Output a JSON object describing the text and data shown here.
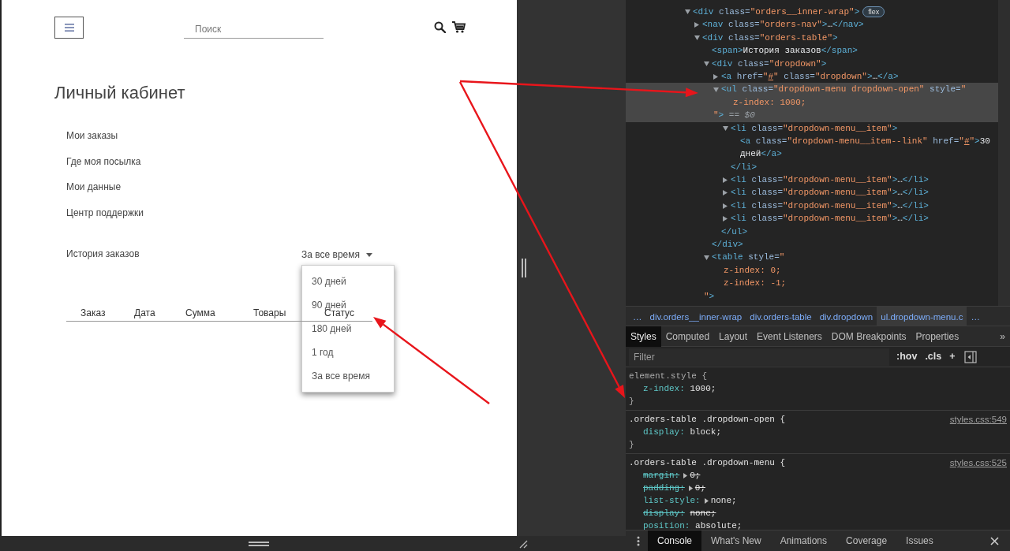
{
  "page": {
    "search": {
      "placeholder": "Поиск"
    },
    "title": "Личный кабинет",
    "nav": [
      {
        "label": "Мои заказы"
      },
      {
        "label": "Где моя посылка"
      },
      {
        "label": "Мои данные"
      },
      {
        "label": "Центр поддержки"
      }
    ],
    "orders": {
      "label": "История заказов",
      "period": {
        "value": "За все время",
        "expanded": true
      },
      "menu": [
        "30 дней",
        "90 дней",
        "180 дней",
        "1 год",
        "За все время"
      ],
      "columns": [
        "Заказ",
        "Дата",
        "Сумма",
        "Товары",
        "Статус"
      ]
    }
  },
  "devtools": {
    "dom_tree": [
      {
        "selected": false,
        "expanded": true,
        "badge": "flex",
        "parts": [
          {
            "kind": "tag",
            "text": "<div "
          },
          {
            "kind": "attr",
            "text": "class="
          },
          {
            "kind": "value",
            "text": "\"orders__inner-wrap\""
          },
          {
            "kind": "tag",
            "text": ">"
          }
        ],
        "children": [
          {
            "selected": false,
            "expanded": false,
            "parts": [
              {
                "kind": "tag",
                "text": "<nav "
              },
              {
                "kind": "attr",
                "text": "class="
              },
              {
                "kind": "value",
                "text": "\"orders-nav\""
              },
              {
                "kind": "tag",
                "text": ">"
              },
              {
                "kind": "text",
                "text": "…"
              },
              {
                "kind": "tag",
                "text": "</nav>"
              }
            ]
          },
          {
            "selected": false,
            "expanded": true,
            "parts": [
              {
                "kind": "tag",
                "text": "<div "
              },
              {
                "kind": "attr",
                "text": "class="
              },
              {
                "kind": "value",
                "text": "\"orders-table\""
              },
              {
                "kind": "tag",
                "text": ">"
              }
            ],
            "children": [
              {
                "selected": false,
                "parts": [
                  {
                    "kind": "tag",
                    "text": "<span>"
                  },
                  {
                    "kind": "text",
                    "text": "История заказов"
                  },
                  {
                    "kind": "tag",
                    "text": "</span>"
                  }
                ]
              },
              {
                "selected": false,
                "expanded": true,
                "parts": [
                  {
                    "kind": "tag",
                    "text": "<div "
                  },
                  {
                    "kind": "attr",
                    "text": "class="
                  },
                  {
                    "kind": "value",
                    "text": "\"dropdown\""
                  },
                  {
                    "kind": "tag",
                    "text": ">"
                  }
                ],
                "close": [
                  {
                    "kind": "tag",
                    "text": "</div>"
                  }
                ],
                "children": [
                  {
                    "selected": false,
                    "expanded": false,
                    "parts": [
                      {
                        "kind": "tag",
                        "text": "<a "
                      },
                      {
                        "kind": "attr",
                        "text": "href="
                      },
                      {
                        "kind": "value",
                        "text": "\""
                      },
                      {
                        "kind": "link",
                        "text": "#"
                      },
                      {
                        "kind": "value",
                        "text": "\""
                      },
                      {
                        "kind": "attr",
                        "text": " class="
                      },
                      {
                        "kind": "value",
                        "text": "\"dropdown\""
                      },
                      {
                        "kind": "tag",
                        "text": ">"
                      },
                      {
                        "kind": "text",
                        "text": "…"
                      },
                      {
                        "kind": "tag",
                        "text": "</a>"
                      }
                    ]
                  },
                  {
                    "selected": true,
                    "expanded": true,
                    "parts": [
                      {
                        "kind": "tag",
                        "text": "<ul "
                      },
                      {
                        "kind": "attr",
                        "text": "class="
                      },
                      {
                        "kind": "value",
                        "text": "\"dropdown-menu dropdown-open\""
                      },
                      {
                        "kind": "attr",
                        "text": " style="
                      },
                      {
                        "kind": "value",
                        "text": "\""
                      }
                    ],
                    "more_lines": [
                      {
                        "kind": "style",
                        "parts": [
                          {
                            "kind": "value",
                            "text": "z-index: 1000;"
                          }
                        ]
                      },
                      {
                        "kind": "closing",
                        "parts": [
                          {
                            "kind": "value",
                            "text": "\""
                          },
                          {
                            "kind": "tag",
                            "text": ">"
                          },
                          {
                            "kind": "dim",
                            "text": " == $0"
                          }
                        ]
                      }
                    ],
                    "close": [
                      {
                        "kind": "tag",
                        "text": "</ul>"
                      }
                    ],
                    "children": [
                      {
                        "selected": false,
                        "expanded": true,
                        "parts": [
                          {
                            "kind": "tag",
                            "text": "<li "
                          },
                          {
                            "kind": "attr",
                            "text": "class="
                          },
                          {
                            "kind": "value",
                            "text": "\"dropdown-menu__item\""
                          },
                          {
                            "kind": "tag",
                            "text": ">"
                          }
                        ],
                        "close": [
                          {
                            "kind": "tag",
                            "text": "</li>"
                          }
                        ],
                        "children": [
                          {
                            "selected": false,
                            "parts": [
                              {
                                "kind": "tag",
                                "text": "<a "
                              },
                              {
                                "kind": "attr",
                                "text": "class="
                              },
                              {
                                "kind": "value",
                                "text": "\"dropdown-menu__item--link\""
                              },
                              {
                                "kind": "attr",
                                "text": " href="
                              },
                              {
                                "kind": "value",
                                "text": "\""
                              },
                              {
                                "kind": "link",
                                "text": "#"
                              },
                              {
                                "kind": "value",
                                "text": "\""
                              },
                              {
                                "kind": "tag",
                                "text": ">"
                              },
                              {
                                "kind": "text",
                                "text": "30"
                              }
                            ],
                            "more_lines": [
                              {
                                "kind": "wrap",
                                "parts": [
                                  {
                                    "kind": "text",
                                    "text": "дней"
                                  },
                                  {
                                    "kind": "tag",
                                    "text": "</a>"
                                  }
                                ]
                              }
                            ]
                          }
                        ]
                      },
                      {
                        "selected": false,
                        "expanded": false,
                        "parts": [
                          {
                            "kind": "tag",
                            "text": "<li "
                          },
                          {
                            "kind": "attr",
                            "text": "class="
                          },
                          {
                            "kind": "value",
                            "text": "\"dropdown-menu__item\""
                          },
                          {
                            "kind": "tag",
                            "text": ">"
                          },
                          {
                            "kind": "text",
                            "text": "…"
                          },
                          {
                            "kind": "tag",
                            "text": "</li>"
                          }
                        ]
                      },
                      {
                        "selected": false,
                        "expanded": false,
                        "parts": [
                          {
                            "kind": "tag",
                            "text": "<li "
                          },
                          {
                            "kind": "attr",
                            "text": "class="
                          },
                          {
                            "kind": "value",
                            "text": "\"dropdown-menu__item\""
                          },
                          {
                            "kind": "tag",
                            "text": ">"
                          },
                          {
                            "kind": "text",
                            "text": "…"
                          },
                          {
                            "kind": "tag",
                            "text": "</li>"
                          }
                        ]
                      },
                      {
                        "selected": false,
                        "expanded": false,
                        "parts": [
                          {
                            "kind": "tag",
                            "text": "<li "
                          },
                          {
                            "kind": "attr",
                            "text": "class="
                          },
                          {
                            "kind": "value",
                            "text": "\"dropdown-menu__item\""
                          },
                          {
                            "kind": "tag",
                            "text": ">"
                          },
                          {
                            "kind": "text",
                            "text": "…"
                          },
                          {
                            "kind": "tag",
                            "text": "</li>"
                          }
                        ]
                      },
                      {
                        "selected": false,
                        "expanded": false,
                        "parts": [
                          {
                            "kind": "tag",
                            "text": "<li "
                          },
                          {
                            "kind": "attr",
                            "text": "class="
                          },
                          {
                            "kind": "value",
                            "text": "\"dropdown-menu__item\""
                          },
                          {
                            "kind": "tag",
                            "text": ">"
                          },
                          {
                            "kind": "text",
                            "text": "…"
                          },
                          {
                            "kind": "tag",
                            "text": "</li>"
                          }
                        ]
                      }
                    ]
                  }
                ]
              },
              {
                "selected": false,
                "expanded": true,
                "parts": [
                  {
                    "kind": "tag",
                    "text": "<table "
                  },
                  {
                    "kind": "attr",
                    "text": "style="
                  },
                  {
                    "kind": "value",
                    "text": "\""
                  }
                ],
                "more_lines": [
                  {
                    "kind": "style",
                    "parts": [
                      {
                        "kind": "value",
                        "text": "z-index: 0;"
                      }
                    ]
                  },
                  {
                    "kind": "style",
                    "parts": [
                      {
                        "kind": "value",
                        "text": "z-index: -1;"
                      }
                    ]
                  },
                  {
                    "kind": "closing",
                    "parts": [
                      {
                        "kind": "value",
                        "text": "\""
                      },
                      {
                        "kind": "tag",
                        "text": ">"
                      }
                    ]
                  }
                ]
              }
            ]
          }
        ]
      }
    ],
    "breadcrumbs": [
      {
        "label": "…",
        "selected": false
      },
      {
        "label": "div.orders__inner-wrap",
        "selected": false
      },
      {
        "label": "div.orders-table",
        "selected": false
      },
      {
        "label": "div.dropdown",
        "selected": false
      },
      {
        "label": "ul.dropdown-menu.c",
        "selected": true
      },
      {
        "label": "…",
        "selected": false
      }
    ],
    "tabs": [
      {
        "label": "Styles",
        "selected": true
      },
      {
        "label": "Computed",
        "selected": false
      },
      {
        "label": "Layout",
        "selected": false
      },
      {
        "label": "Event Listeners",
        "selected": false
      },
      {
        "label": "DOM Breakpoints",
        "selected": false
      },
      {
        "label": "Properties",
        "selected": false
      }
    ],
    "tabs_more": "»",
    "filter": {
      "placeholder": "Filter"
    },
    "tools": [
      ":hov",
      ".cls",
      "+"
    ],
    "rules": [
      {
        "selector": "element.style {",
        "close": "}",
        "declarations": [
          {
            "property": "z-index:",
            "value": "1000;",
            "struck": false,
            "shorthand": false
          }
        ]
      },
      {
        "selector": ".orders-table .dropdown-open {",
        "source": "styles.css:549",
        "close": "}",
        "declarations": [
          {
            "property": "display:",
            "value": "block;",
            "struck": false,
            "shorthand": false
          }
        ]
      },
      {
        "selector": ".orders-table .dropdown-menu {",
        "source": "styles.css:525",
        "declarations": [
          {
            "property": "margin:",
            "value": "0;",
            "struck": true,
            "shorthand": true
          },
          {
            "property": "padding:",
            "value": "0;",
            "struck": true,
            "shorthand": true
          },
          {
            "property": "list-style:",
            "value": "none;",
            "struck": false,
            "shorthand": true
          },
          {
            "property": "display:",
            "value": "none;",
            "struck": true,
            "shorthand": false
          },
          {
            "property": "position:",
            "value": "absolute;",
            "struck": false,
            "shorthand": false
          }
        ]
      }
    ],
    "drawer_tabs": [
      {
        "label": "Console",
        "selected": true
      },
      {
        "label": "What's New",
        "selected": false
      },
      {
        "label": "Animations",
        "selected": false
      },
      {
        "label": "Coverage",
        "selected": false
      },
      {
        "label": "Issues",
        "selected": false
      }
    ]
  }
}
